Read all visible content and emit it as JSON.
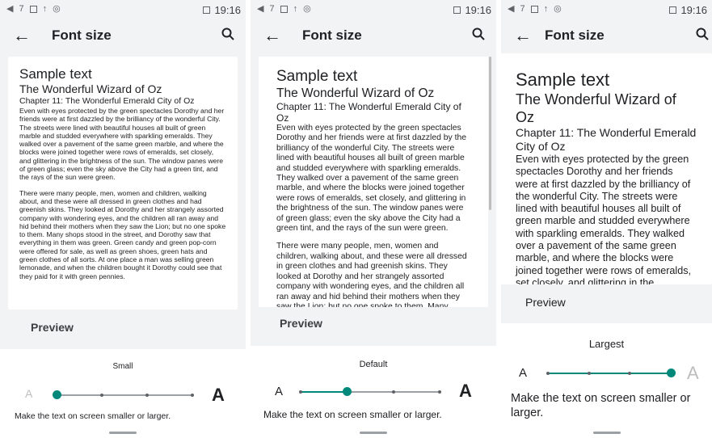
{
  "status": {
    "time": "19:16",
    "signal": "7",
    "icons": [
      "volume-icon",
      "image-icon",
      "upload-icon",
      "cast-icon"
    ],
    "battery_icon": "battery-saver-icon"
  },
  "appbar": {
    "title": "Font size",
    "back_icon": "arrow-back-icon",
    "search_icon": "search-icon"
  },
  "sample": {
    "heading": "Sample text",
    "book": "The Wonderful Wizard of Oz",
    "chapter": "Chapter 11: The Wonderful Emerald City of Oz",
    "para1": "Even with eyes protected by the green spectacles Dorothy and her friends were at first dazzled by the brilliancy of the wonderful City. The streets were lined with beautiful houses all built of green marble and studded everywhere with sparkling emeralds. They walked over a pavement of the same green marble, and where the blocks were joined together were rows of emeralds, set closely, and glittering in the brightness of the sun. The window panes were of green glass; even the sky above the City had a green tint, and the rays of the sun were green.",
    "para2": "There were many people, men, women and children, walking about, and these were all dressed in green clothes and had greenish skins. They looked at Dorothy and her strangely assorted company with wondering eyes, and the children all ran away and hid behind their mothers when they saw the Lion; but no one spoke to them. Many shops stood in the street, and Dorothy saw that everything in them was green. Green candy and green pop-corn were offered for sale, as well as green shoes, green hats and green clothes of all sorts. At one place a man was selling green lemonade, and when the children bought it Dorothy could see that they paid for it with green pennies."
  },
  "preview_label": "Preview",
  "control": {
    "small_a": "A",
    "large_a": "A",
    "hint": "Make the text on screen smaller or larger."
  },
  "panels": [
    {
      "size_label": "Small",
      "level_index": 0
    },
    {
      "size_label": "Default",
      "level_index": 1
    },
    {
      "size_label": "Largest",
      "level_index": 3
    }
  ],
  "accent_color": "#00897b"
}
